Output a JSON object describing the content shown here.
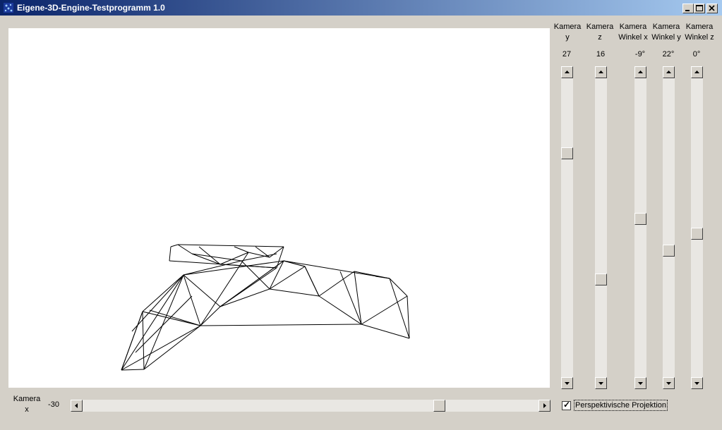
{
  "window": {
    "title": "Eigene-3D-Engine-Testprogramm 1.0"
  },
  "camera_x": {
    "label_line1": "Kamera",
    "label_line2": "x",
    "value": "-30",
    "slider_fraction": 0.79
  },
  "vertical_sliders": [
    {
      "label_line1": "Kamera",
      "label_line2": "y",
      "value": "27",
      "slider_fraction": 0.24
    },
    {
      "label_line1": "Kamera",
      "label_line2": "z",
      "value": "16",
      "slider_fraction": 0.68
    },
    {
      "label_line1": "Kamera",
      "label_line2": "Winkel x",
      "value": "-9°",
      "slider_fraction": 0.47
    },
    {
      "label_line1": "Kamera",
      "label_line2": "Winkel y",
      "value": "22°",
      "slider_fraction": 0.58
    },
    {
      "label_line1": "Kamera",
      "label_line2": "Winkel z",
      "value": "0°",
      "slider_fraction": 0.52
    }
  ],
  "perspective": {
    "label": "Perspektivische Projektion",
    "checked": true,
    "check_glyph": "✓"
  },
  "icons": {
    "app": "app-icon",
    "minimize": "minimize-icon",
    "maximize": "maximize-icon",
    "close": "close-icon"
  },
  "colors": {
    "titlebar_start": "#0a246a",
    "titlebar_end": "#a6caf0",
    "face": "#d4d0c8",
    "canvas": "#ffffff"
  }
}
